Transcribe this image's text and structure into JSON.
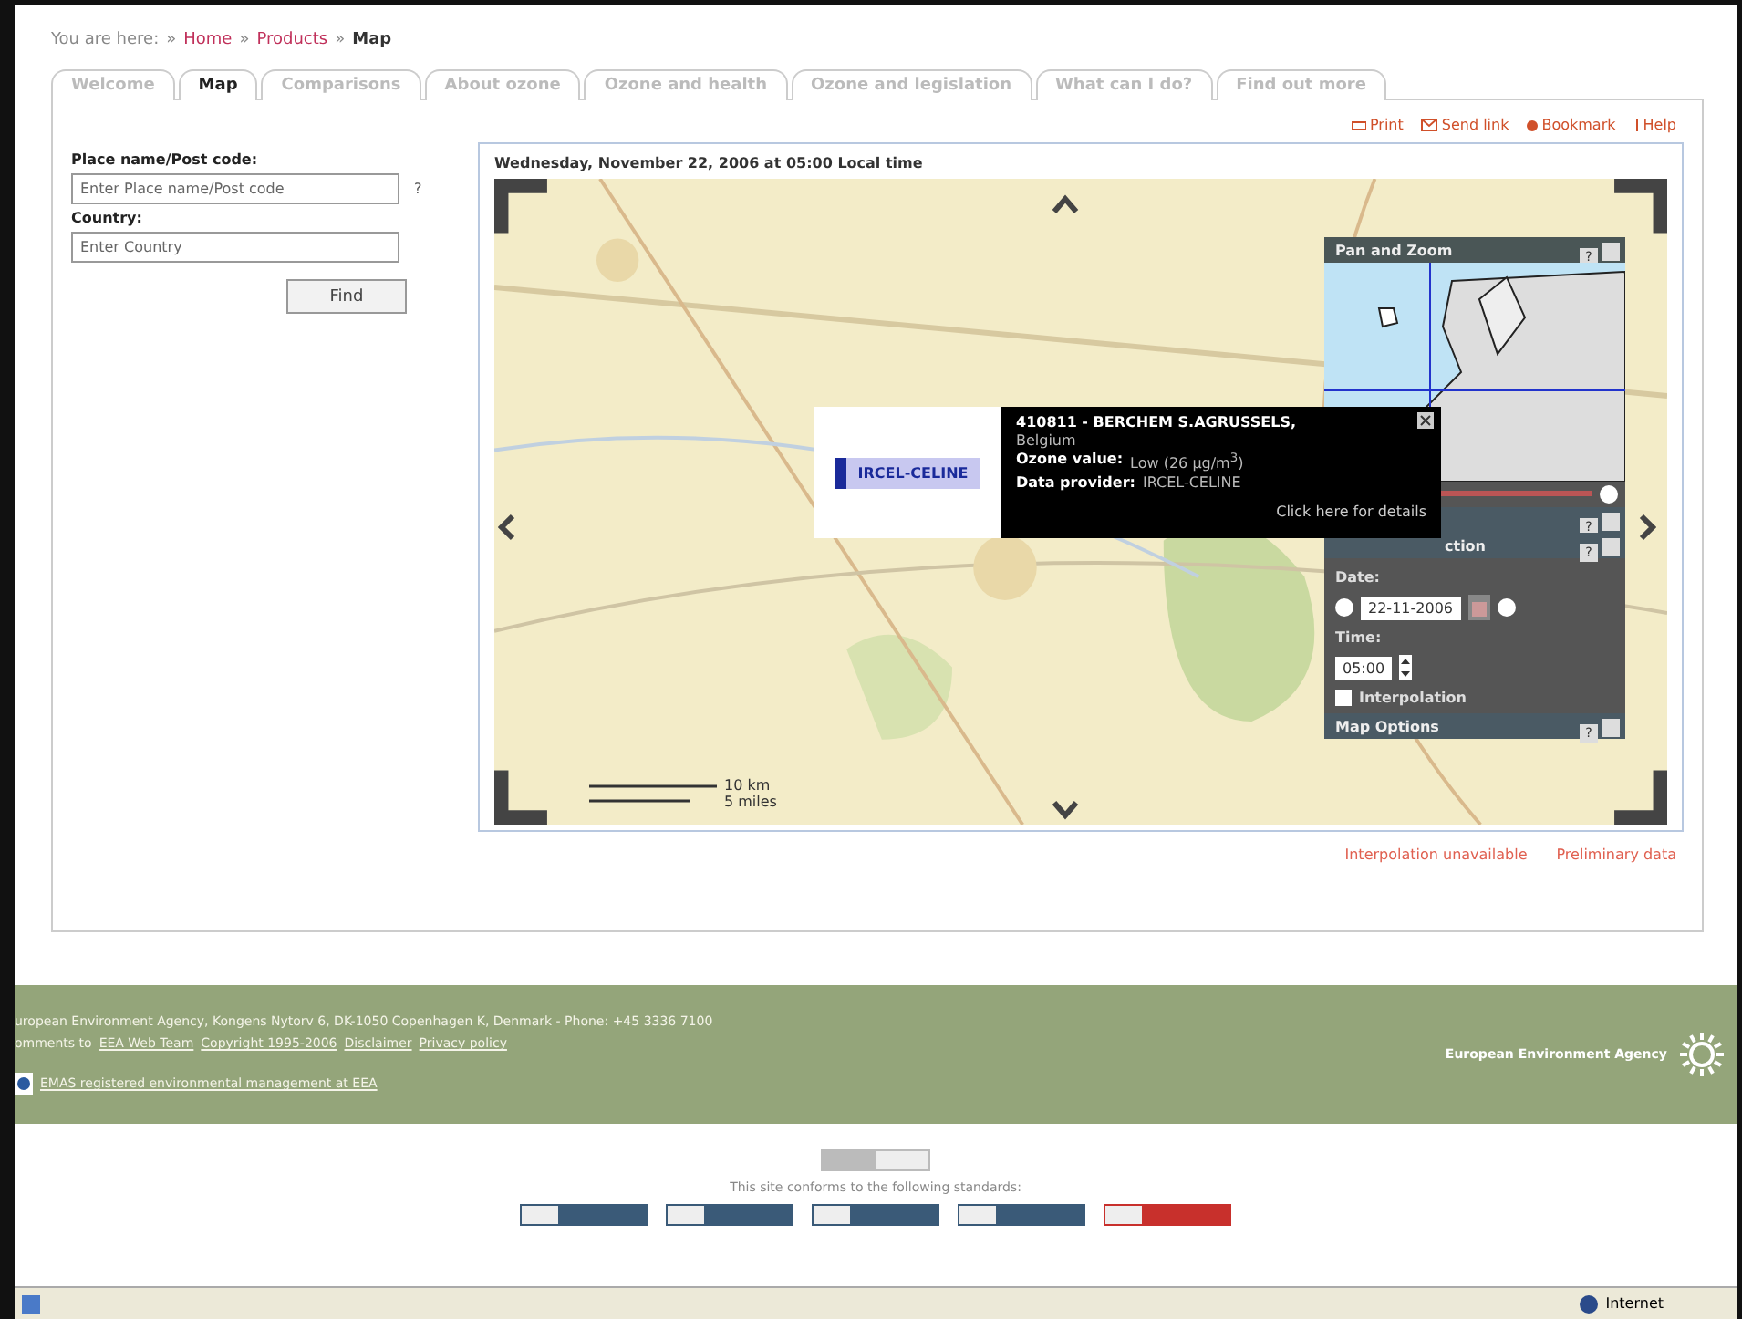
{
  "breadcrumb": {
    "prefix": "You are here:",
    "separator": "»",
    "items": [
      {
        "label": "Home",
        "kind": "link"
      },
      {
        "label": "Products",
        "kind": "link"
      },
      {
        "label": "Map",
        "kind": "current"
      }
    ]
  },
  "tabs": [
    {
      "label": "Welcome",
      "selected": false
    },
    {
      "label": "Map",
      "selected": true
    },
    {
      "label": "Comparisons",
      "selected": false
    },
    {
      "label": "About ozone",
      "selected": false
    },
    {
      "label": "Ozone and health",
      "selected": false
    },
    {
      "label": "Ozone and legislation",
      "selected": false
    },
    {
      "label": "What can I do?",
      "selected": false
    },
    {
      "label": "Find out more",
      "selected": false
    }
  ],
  "tools": [
    {
      "label": "Print",
      "kind": "print"
    },
    {
      "label": "Send link",
      "kind": "mail"
    },
    {
      "label": "Bookmark",
      "kind": "bookmark"
    },
    {
      "label": "Help",
      "kind": "help"
    }
  ],
  "search": {
    "place_label": "Place name/Post code:",
    "place_placeholder": "Enter Place name/Post code",
    "help": "?",
    "country_label": "Country:",
    "country_placeholder": "Enter Country",
    "button": "Find"
  },
  "map": {
    "date_line": "Wednesday, November 22, 2006 at 05:00 Local time",
    "scale": [
      "10 km",
      "5 miles"
    ],
    "popup": {
      "logo": "IRCEL-CELINE",
      "title": "410811 - BERCHEM S.AGRUSSELS,",
      "subtitle": "Belgium",
      "rows": [
        {
          "label": "Ozone value:",
          "value": "Low (26 µg/m$^{3}$)"
        },
        {
          "label": "Data provider:",
          "value": "IRCEL-CELINE"
        }
      ],
      "link": "Click here for details"
    },
    "panel": {
      "pan_zoom_title": "Pan and Zoom",
      "help": "?",
      "time_title": "ction",
      "date_label": "Date:",
      "date_value": "22-11-2006",
      "time_label": "Time:",
      "time_value": "05:00",
      "interpolation": {
        "label": "Interpolation",
        "checked": false
      },
      "options_title": "Map Options"
    }
  },
  "notes": [
    "Interpolation unavailable",
    "Preliminary data"
  ],
  "footer": {
    "address": "uropean Environment Agency, Kongens Nytorv 6, DK-1050 Copenhagen K, Denmark - Phone: +45 3336 7100",
    "comments_prefix": "omments to",
    "links": [
      "EEA Web Team",
      "Copyright 1995-2006",
      "Disclaimer",
      "Privacy policy"
    ],
    "emas": "EMAS registered environmental management at EEA",
    "agency": "European Environment Agency"
  },
  "standards": {
    "text": "This site conforms to the following standards:",
    "badges": [
      {
        "color": "#3a5a78"
      },
      {
        "color": "#3a5a78"
      },
      {
        "color": "#3a5a78"
      },
      {
        "color": "#3a5a78"
      },
      {
        "color": "#c8302c"
      }
    ]
  },
  "status_bar": {
    "zone": "Internet"
  }
}
